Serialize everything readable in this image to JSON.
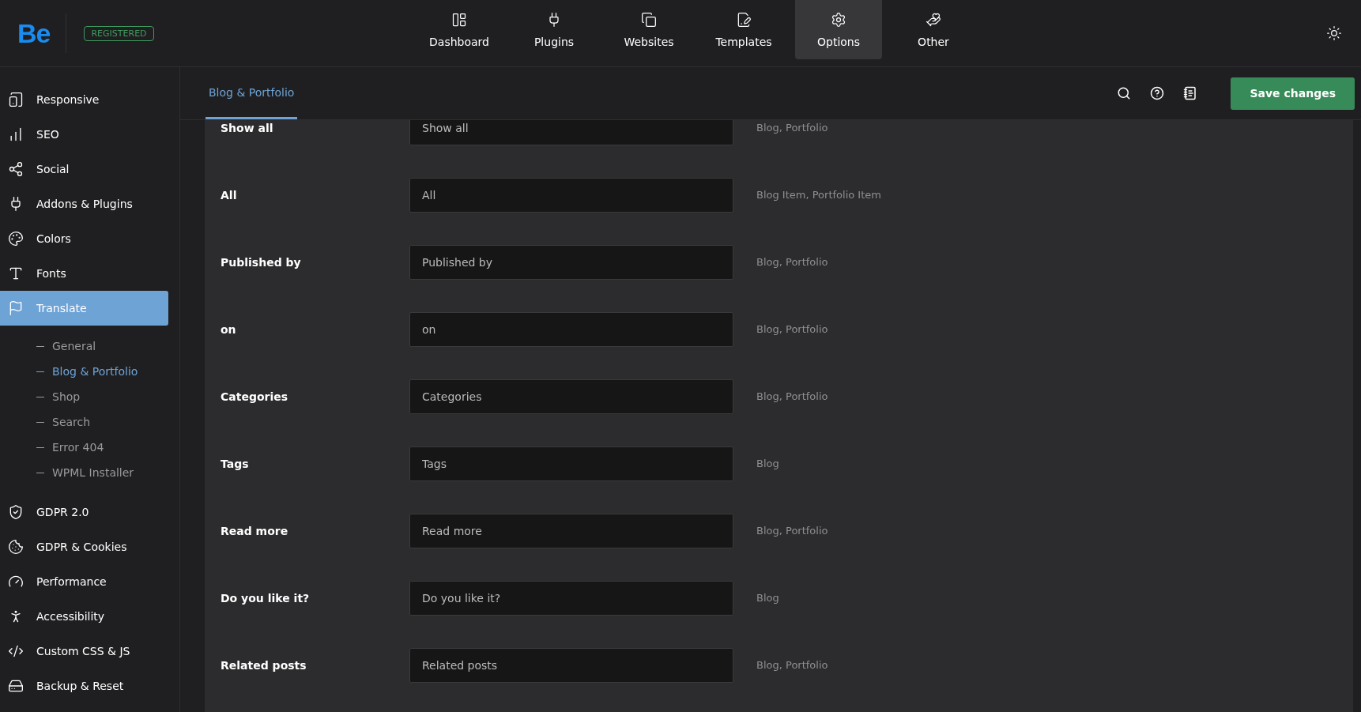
{
  "header": {
    "logo": "Be",
    "badge": "REGISTERED"
  },
  "nav": [
    {
      "label": "Dashboard",
      "selected": false
    },
    {
      "label": "Plugins",
      "selected": false
    },
    {
      "label": "Websites",
      "selected": false
    },
    {
      "label": "Templates",
      "selected": false
    },
    {
      "label": "Options",
      "selected": true
    },
    {
      "label": "Other",
      "selected": false
    }
  ],
  "sidebar": {
    "items": [
      {
        "label": "Responsive",
        "selected": false
      },
      {
        "label": "SEO",
        "selected": false
      },
      {
        "label": "Social",
        "selected": false
      },
      {
        "label": "Addons & Plugins",
        "selected": false
      },
      {
        "label": "Colors",
        "selected": false
      },
      {
        "label": "Fonts",
        "selected": false
      },
      {
        "label": "Translate",
        "selected": true,
        "children": [
          {
            "label": "General",
            "selected": false
          },
          {
            "label": "Blog & Portfolio",
            "selected": true
          },
          {
            "label": "Shop",
            "selected": false
          },
          {
            "label": "Search",
            "selected": false
          },
          {
            "label": "Error 404",
            "selected": false
          },
          {
            "label": "WPML Installer",
            "selected": false
          }
        ]
      },
      {
        "label": "GDPR 2.0",
        "selected": false
      },
      {
        "label": "GDPR & Cookies",
        "selected": false
      },
      {
        "label": "Performance",
        "selected": false
      },
      {
        "label": "Accessibility",
        "selected": false
      },
      {
        "label": "Custom CSS & JS",
        "selected": false
      },
      {
        "label": "Backup & Reset",
        "selected": false
      }
    ]
  },
  "subheader": {
    "tabs": [
      {
        "label": "Blog & Portfolio",
        "selected": true
      }
    ],
    "save_button": "Save changes"
  },
  "fields": [
    {
      "label": "Show all",
      "value": "Show all",
      "usage": "Blog, Portfolio"
    },
    {
      "label": "All",
      "value": "All",
      "usage": "Blog Item, Portfolio Item"
    },
    {
      "label": "Published by",
      "value": "Published by",
      "usage": "Blog, Portfolio"
    },
    {
      "label": "on",
      "value": "on",
      "usage": "Blog, Portfolio"
    },
    {
      "label": "Categories",
      "value": "Categories",
      "usage": "Blog, Portfolio"
    },
    {
      "label": "Tags",
      "value": "Tags",
      "usage": "Blog"
    },
    {
      "label": "Read more",
      "value": "Read more",
      "usage": "Blog, Portfolio"
    },
    {
      "label": "Do you like it?",
      "value": "Do you like it?",
      "usage": "Blog"
    },
    {
      "label": "Related posts",
      "value": "Related posts",
      "usage": "Blog, Portfolio"
    }
  ]
}
